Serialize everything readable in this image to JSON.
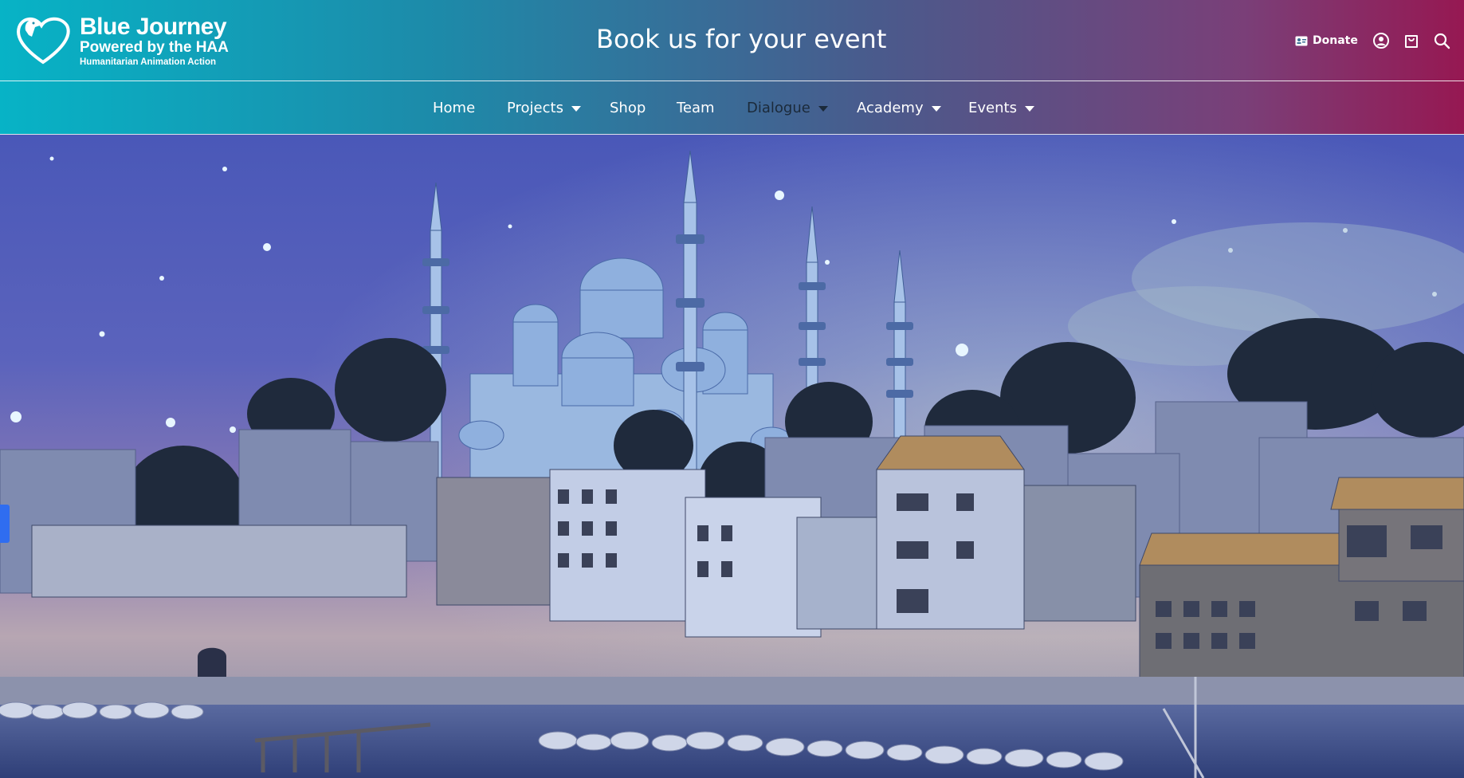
{
  "brand": {
    "title": "Blue Journey",
    "subtitle": "Powered by the HAA",
    "tagline": "Humanitarian Animation Action"
  },
  "header": {
    "cta": "Book us for your event"
  },
  "utility": {
    "donate_label": "Donate",
    "icons": [
      "id-card-icon",
      "account-icon",
      "cart-icon",
      "search-icon"
    ]
  },
  "nav": {
    "items": [
      {
        "label": "Home",
        "dropdown": false
      },
      {
        "label": "Projects",
        "dropdown": true
      },
      {
        "label": "Shop",
        "dropdown": false
      },
      {
        "label": "Team",
        "dropdown": false
      },
      {
        "label": "Dialogue",
        "dropdown": true,
        "active": true
      },
      {
        "label": "Academy",
        "dropdown": true
      },
      {
        "label": "Events",
        "dropdown": true
      }
    ]
  },
  "colors": {
    "header_start": "#07b3c6",
    "header_end": "#961852",
    "side_tab": "#2f6df0"
  }
}
